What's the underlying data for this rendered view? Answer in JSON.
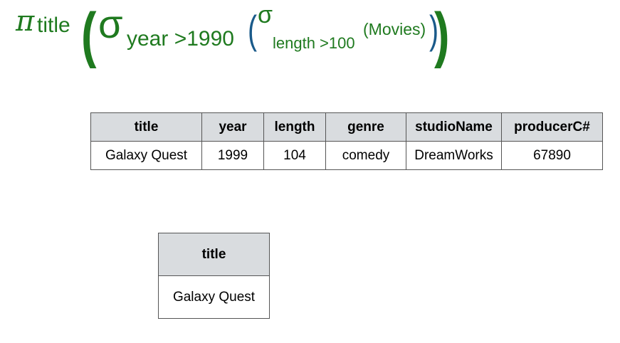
{
  "expression": {
    "projection_symbol": "π",
    "projection_attr": "title",
    "outer_open": "(",
    "outer_close": ")",
    "selection1_symbol": "σ",
    "selection1_condition": "year >1990",
    "inner_open": "(",
    "inner_close": ")",
    "selection2_symbol": "σ",
    "selection2_condition": "length >100",
    "relation": "(Movies)",
    "colors": {
      "expression": "#1f7a1f",
      "inner_paren": "#1a5a8a"
    }
  },
  "movies_table": {
    "columns": [
      "title",
      "year",
      "length",
      "genre",
      "studioName",
      "producerC#"
    ],
    "rows": [
      [
        "Galaxy Quest",
        "1999",
        "104",
        "comedy",
        "DreamWorks",
        "67890"
      ]
    ]
  },
  "result_table": {
    "columns": [
      "title"
    ],
    "rows": [
      [
        "Galaxy Quest"
      ]
    ]
  },
  "colors": {
    "header_bg": "#d9dcdf",
    "border": "#555555"
  }
}
